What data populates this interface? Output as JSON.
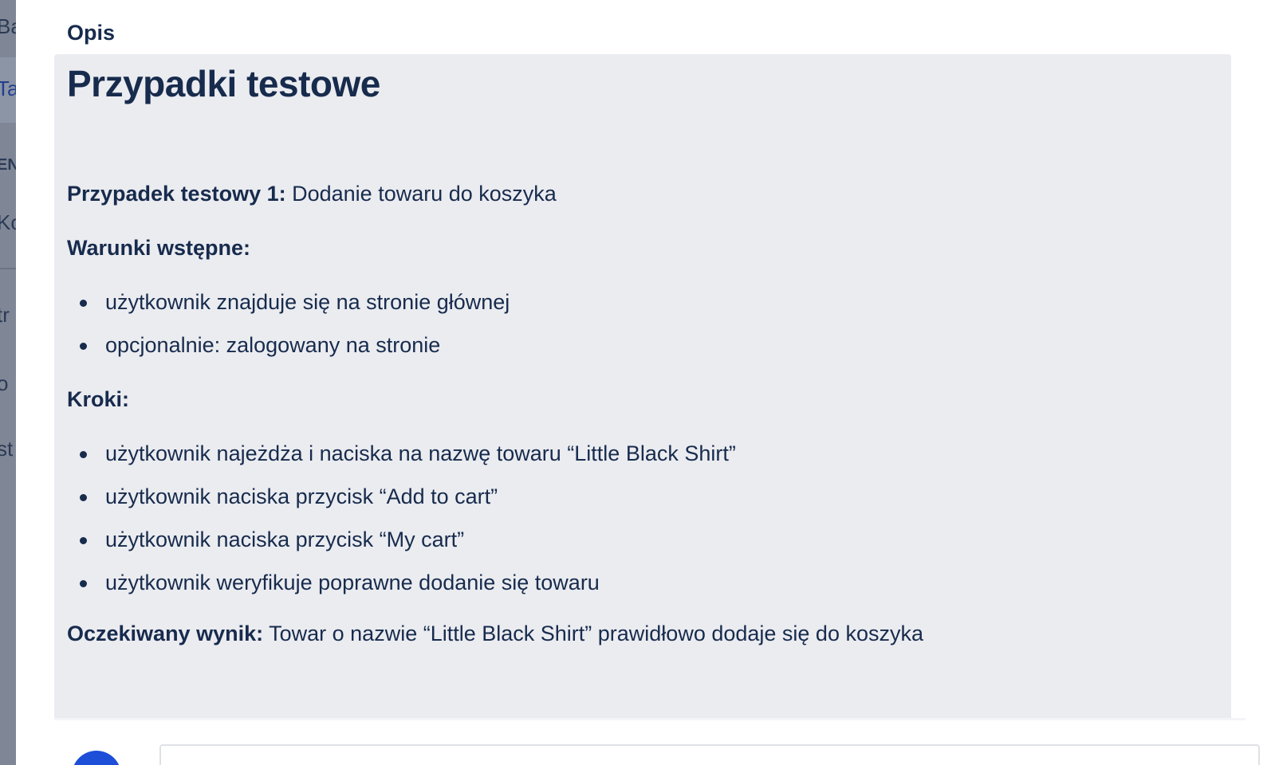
{
  "background_sidebar": {
    "fragments": [
      "Ba",
      "Ta",
      "EN",
      "Ko",
      "tr",
      "o",
      "st"
    ]
  },
  "modal": {
    "section_label": "Opis",
    "description": {
      "title": "Przypadki testowe",
      "test_case_label": "Przypadek testowy 1:",
      "test_case_value": " Dodanie towaru do koszyka",
      "preconditions_label": "Warunki wstępne:",
      "preconditions": [
        "użytkownik znajduje się na stronie głównej",
        "opcjonalnie: zalogowany na stronie"
      ],
      "steps_label": "Kroki:",
      "steps": [
        "użytkownik najeżdża i naciska na nazwę towaru “Little Black Shirt”",
        "użytkownik naciska przycisk “Add to cart”",
        "użytkownik naciska przycisk “My cart”",
        "użytkownik weryfikuje poprawne dodanie się towaru"
      ],
      "expected_label": "Oczekiwany wynik:",
      "expected_value": " Towar o nazwie “Little Black Shirt” prawidłowo dodaje się do koszyka"
    },
    "comment": {
      "placeholder": ""
    }
  },
  "colors": {
    "text": "#172b4d",
    "description_bg": "#ebecf0",
    "avatar": "#1d4ed8",
    "overlay": "#7f8796"
  }
}
